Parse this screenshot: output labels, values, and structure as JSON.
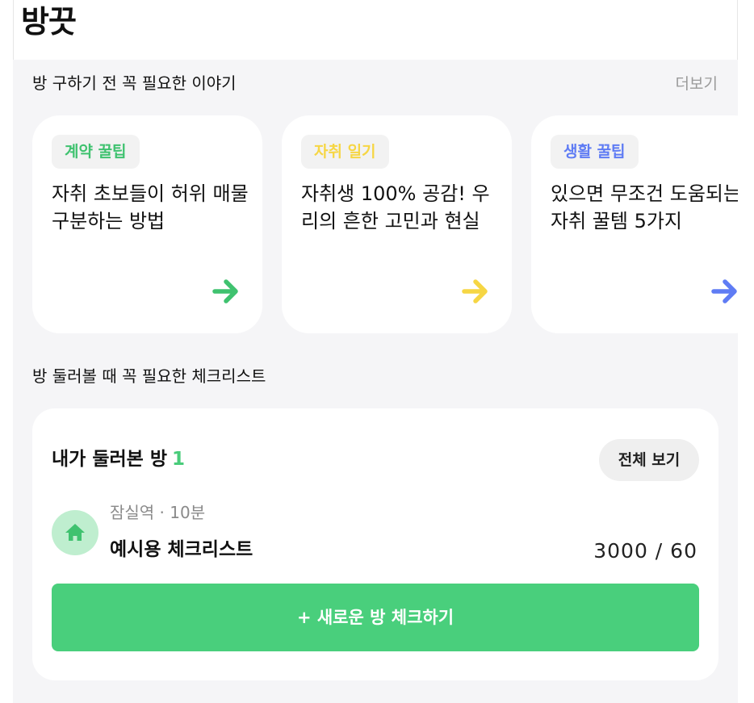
{
  "header": {
    "logo": "방끗"
  },
  "stories": {
    "title": "방 구하기 전 꼭 필요한 이야기",
    "more_label": "더보기",
    "cards": [
      {
        "tag": "계약 꿀팁",
        "tag_color": "#3fc26f",
        "title": "자취 초보들이 허위 매물 구분하는 방법",
        "arrow_color": "#3fc26f",
        "arrow_icon": "arrow-right-icon"
      },
      {
        "tag": "자취 일기",
        "tag_color": "#f6d644",
        "title": "자취생 100% 공감! 우리의 흔한 고민과 현실",
        "arrow_color": "#f6d644",
        "arrow_icon": "arrow-right-icon"
      },
      {
        "tag": "생활 꿀팁",
        "tag_color": "#5f7cf4",
        "title": "있으면 무조건 도움되는 자취 꿀템 5가지",
        "arrow_color": "#5f7cf4",
        "arrow_icon": "arrow-right-icon"
      }
    ]
  },
  "checklist": {
    "title": "방 둘러볼 때 꼭 필요한 체크리스트",
    "visited_label": "내가 둘러본 방",
    "visited_count": "1",
    "view_all_label": "전체 보기",
    "room": {
      "icon": "home-icon",
      "meta": "잠실역 · 10분",
      "name": "예시용 체크리스트",
      "score": "3000 / 60"
    },
    "new_button_label": "+ 새로운 방 체크하기"
  },
  "colors": {
    "accent": "#49cf7c",
    "background": "#f5f5f7"
  }
}
